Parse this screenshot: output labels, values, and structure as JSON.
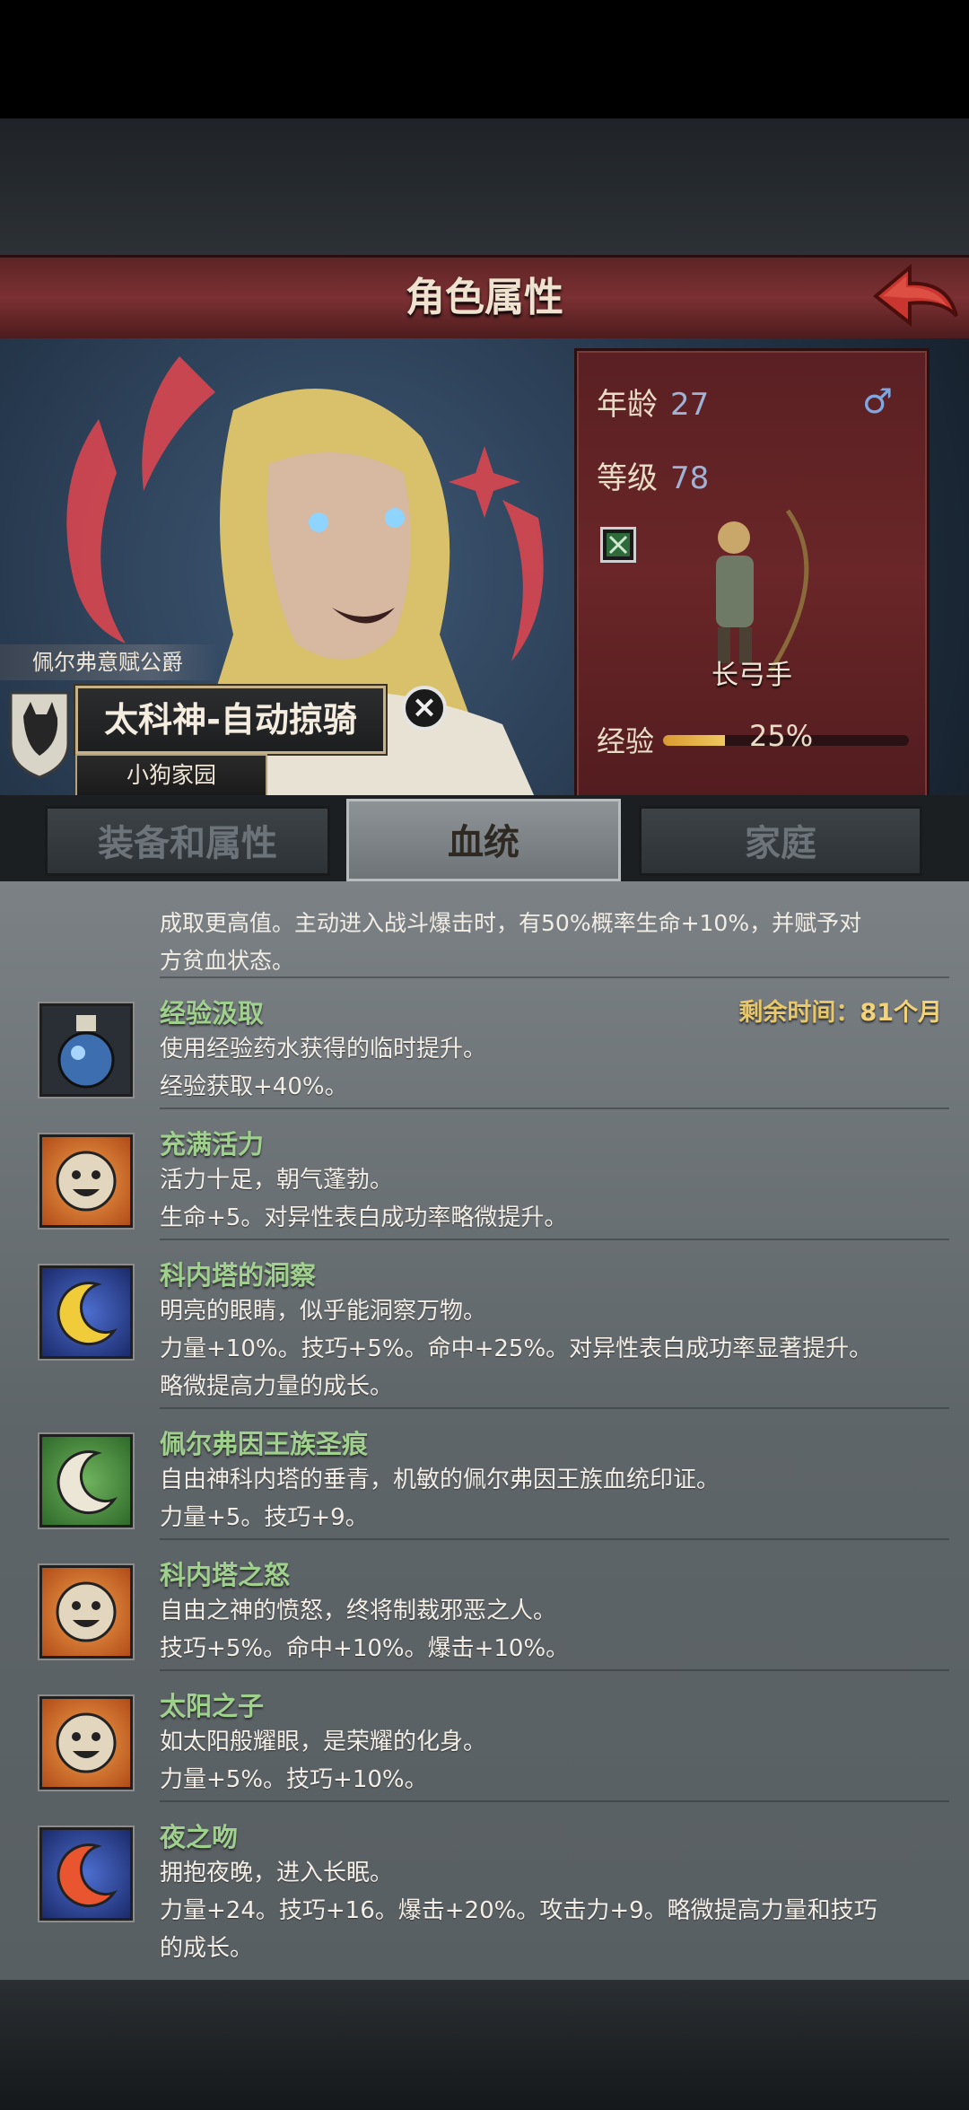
{
  "header": {
    "title": "角色属性"
  },
  "character": {
    "title_tag": "佩尔弗意赋公爵",
    "name": "太科神-自动掠骑",
    "family": "小狗家园",
    "age_label": "年龄",
    "age": "27",
    "gender_symbol": "♂",
    "level_label": "等级",
    "level": "78",
    "class_name": "长弓手",
    "exp_label": "经验",
    "exp_percent_text": "25%",
    "exp_fraction": 0.25
  },
  "tabs": [
    {
      "label": "装备和属性"
    },
    {
      "label": "血统"
    },
    {
      "label": "家庭"
    }
  ],
  "active_tab": 1,
  "prev_trait_desc": [
    "成取更高值。主动进入战斗爆击时，有50%概率生命+10%，并赋予对",
    "方贫血状态。"
  ],
  "traits": [
    {
      "icon": "potion-icon",
      "name": "经验汲取",
      "remaining_label": "剩余时间：",
      "remaining_value": "81个月",
      "lines": [
        "使用经验药水获得的临时提升。",
        "经验获取+40%。"
      ]
    },
    {
      "icon": "sun-smile-icon",
      "name": "充满活力",
      "lines": [
        "活力十足，朝气蓬勃。",
        "生命+5。对异性表白成功率略微提升。"
      ]
    },
    {
      "icon": "moon-icon",
      "name": "科内塔的洞察",
      "lines": [
        "明亮的眼睛，似乎能洞察万物。",
        "力量+10%。技巧+5%。命中+25%。对异性表白成功率显著提升。",
        "略微提高力量的成长。"
      ]
    },
    {
      "icon": "moon-green-icon",
      "name": "佩尔弗因王族圣痕",
      "lines": [
        "自由神科内塔的垂青，机敏的佩尔弗因王族血统印证。",
        "力量+5。技巧+9。"
      ]
    },
    {
      "icon": "sun-smile-icon",
      "name": "科内塔之怒",
      "lines": [
        "自由之神的愤怒，终将制裁邪恶之人。",
        "技巧+5%。命中+10%。爆击+10%。"
      ]
    },
    {
      "icon": "sun-smile-icon",
      "name": "太阳之子",
      "lines": [
        "如太阳般耀眼，是荣耀的化身。",
        "力量+5%。技巧+10%。"
      ]
    },
    {
      "icon": "moon-red-icon",
      "name": "夜之吻",
      "lines": [
        "拥抱夜晚，进入长眠。",
        "力量+24。技巧+16。爆击+20%。攻击力+9。略微提高力量和技巧",
        "的成长。"
      ]
    }
  ]
}
